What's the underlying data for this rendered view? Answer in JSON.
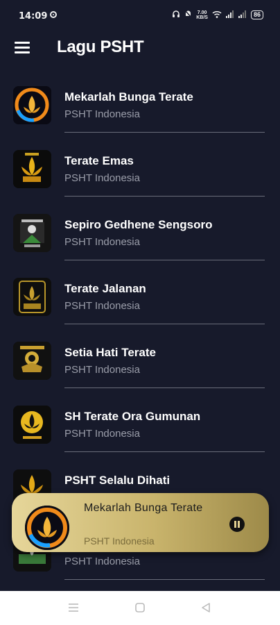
{
  "status_bar": {
    "time": "14:09",
    "net_speed_value": "7.00",
    "net_speed_unit": "KB/S",
    "battery": "86"
  },
  "app_bar": {
    "title": "Lagu PSHT",
    "menu_icon": "hamburger-icon"
  },
  "songs": [
    {
      "title": "Mekarlah Bunga Terate",
      "artist": "PSHT Indonesia"
    },
    {
      "title": "Terate Emas",
      "artist": "PSHT Indonesia"
    },
    {
      "title": "Sepiro Gedhene Sengsoro",
      "artist": "PSHT Indonesia"
    },
    {
      "title": "Terate Jalanan",
      "artist": "PSHT Indonesia"
    },
    {
      "title": "Setia Hati Terate",
      "artist": "PSHT Indonesia"
    },
    {
      "title": "SH Terate Ora Gumunan",
      "artist": "PSHT Indonesia"
    },
    {
      "title": "PSHT Selalu Dihati",
      "artist": ""
    },
    {
      "title": "",
      "artist": "PSHT Indonesia"
    }
  ],
  "now_playing": {
    "title": "Mekarlah Bunga Terate",
    "artist": "PSHT Indonesia",
    "control_icon": "pause-icon"
  },
  "nav_bar": {
    "icons": [
      "recents-icon",
      "home-icon",
      "back-icon"
    ]
  },
  "colors": {
    "background": "#171a2b",
    "accent_gold": "#c9b46c",
    "divider": "#6a6d7a"
  }
}
